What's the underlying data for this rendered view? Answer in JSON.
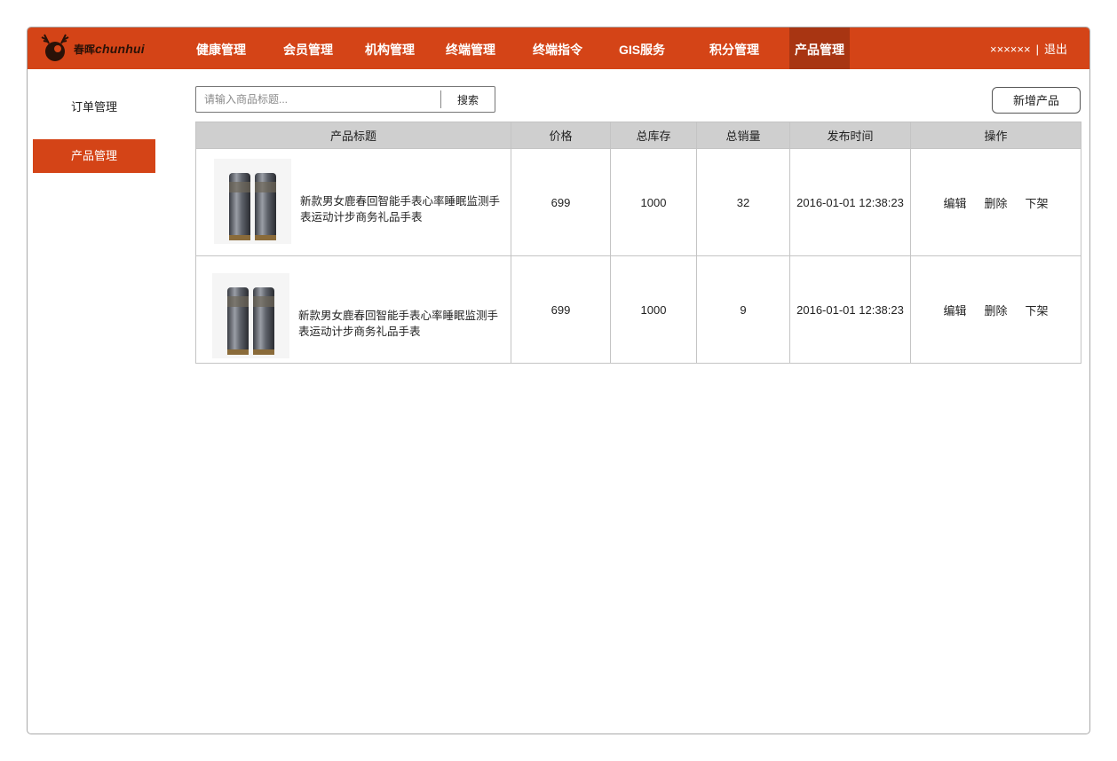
{
  "brand": {
    "name_cn": "春晖",
    "name_en": "chunhui"
  },
  "nav": {
    "items": [
      {
        "label": "健康管理"
      },
      {
        "label": "会员管理"
      },
      {
        "label": "机构管理"
      },
      {
        "label": "终端管理"
      },
      {
        "label": "终端指令"
      },
      {
        "label": "GIS服务"
      },
      {
        "label": "积分管理"
      },
      {
        "label": "产品管理",
        "active": true
      }
    ]
  },
  "user": {
    "name": "××××××",
    "separator": "|",
    "logout_label": "退出"
  },
  "sidebar": {
    "items": [
      {
        "label": "订单管理"
      },
      {
        "label": "产品管理",
        "active": true
      }
    ]
  },
  "search": {
    "placeholder": "请输入商品标题...",
    "value": "",
    "button_label": "搜索"
  },
  "toolbar": {
    "add_label": "新增产品"
  },
  "table": {
    "columns": [
      "产品标题",
      "价格",
      "总库存",
      "总销量",
      "发布时间",
      "操作"
    ],
    "rows": [
      {
        "title": "新款男女鹿春回智能手表心率睡眠监测手表运动计步商务礼品手表",
        "price": "699",
        "stock": "1000",
        "sales": "32",
        "published": "2016-01-01 12:38:23",
        "actions": [
          "编辑",
          "删除",
          "下架"
        ]
      },
      {
        "title": "新款男女鹿春回智能手表心率睡眠监测手表运动计步商务礼品手表",
        "price": "699",
        "stock": "1000",
        "sales": "9",
        "published": "2016-01-01 12:38:23",
        "actions": [
          "编辑",
          "删除",
          "下架"
        ]
      }
    ]
  },
  "colors": {
    "accent": "#d44417",
    "active_nav": "#a83512",
    "header_bg": "#cfcfcf"
  }
}
